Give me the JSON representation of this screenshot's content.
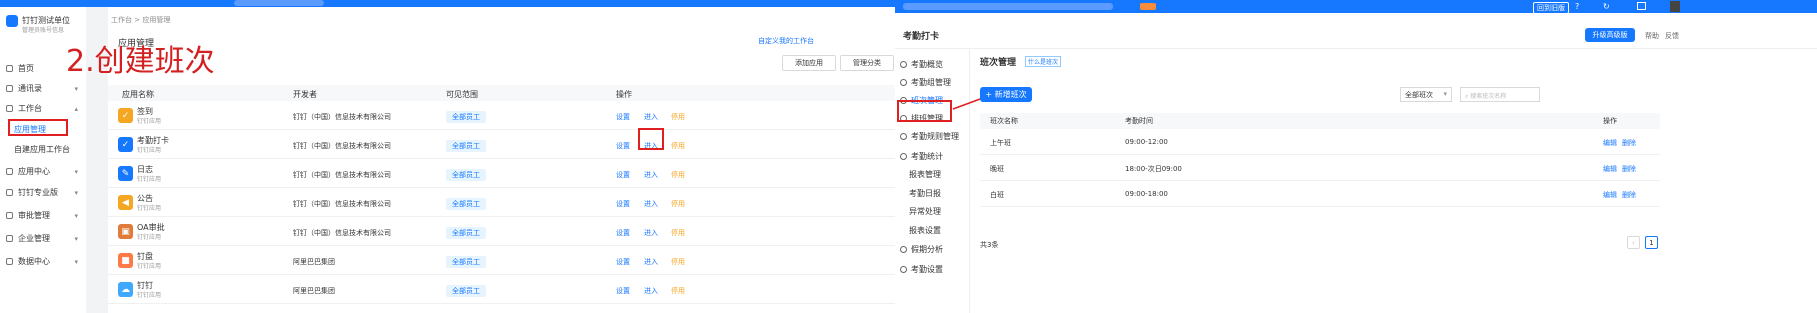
{
  "left": {
    "sidebar": {
      "user_name": "钉钉测试单位",
      "user_sub": "管理员账号信息",
      "items": [
        {
          "label": "首页",
          "caret": ""
        },
        {
          "label": "通讯录",
          "caret": "▾"
        },
        {
          "label": "工作台",
          "caret": "▴"
        },
        {
          "label": "应用管理",
          "caret": ""
        },
        {
          "label": "自建应用工作台",
          "caret": ""
        },
        {
          "label": "应用中心",
          "caret": "▾"
        },
        {
          "label": "钉钉专业版",
          "caret": "▾"
        },
        {
          "label": "审批管理",
          "caret": "▾"
        },
        {
          "label": "企业管理",
          "caret": "▾"
        },
        {
          "label": "数据中心",
          "caret": "▾"
        }
      ]
    },
    "header": {
      "breadcrumb": "工作台 > 应用管理",
      "section_title": "应用管理",
      "link": "自定义我的工作台",
      "btn1": "添加应用",
      "btn2": "管理分类"
    },
    "step_label": "2.创建班次",
    "table": {
      "headers": [
        "应用名称",
        "开发者",
        "可见范围",
        "操作"
      ],
      "rows": [
        {
          "name": "签到",
          "sub": "钉钉应用",
          "dev": "钉钉（中国）信息技术有限公司",
          "scope": "全部员工",
          "color": "#f5a623",
          "icon": "✓",
          "a1": "设置",
          "a2": "进入",
          "a3": "停用"
        },
        {
          "name": "考勤打卡",
          "sub": "钉钉应用",
          "dev": "钉钉（中国）信息技术有限公司",
          "scope": "全部员工",
          "color": "#1677ff",
          "icon": "✓",
          "a1": "设置",
          "a2": "进入",
          "a3": "停用"
        },
        {
          "name": "日志",
          "sub": "钉钉应用",
          "dev": "钉钉（中国）信息技术有限公司",
          "scope": "全部员工",
          "color": "#1677ff",
          "icon": "✎",
          "a1": "设置",
          "a2": "进入",
          "a3": "停用"
        },
        {
          "name": "公告",
          "sub": "钉钉应用",
          "dev": "钉钉（中国）信息技术有限公司",
          "scope": "全部员工",
          "color": "#f5a623",
          "icon": "◀",
          "a1": "设置",
          "a2": "进入",
          "a3": "停用"
        },
        {
          "name": "OA审批",
          "sub": "钉钉应用",
          "dev": "钉钉（中国）信息技术有限公司",
          "scope": "全部员工",
          "color": "#e07b39",
          "icon": "▣",
          "a1": "设置",
          "a2": "进入",
          "a3": "停用"
        },
        {
          "name": "钉盘",
          "sub": "钉钉应用",
          "dev": "阿里巴巴集团",
          "scope": "全部员工",
          "color": "#ff7a45",
          "icon": "■",
          "a1": "设置",
          "a2": "进入",
          "a3": "停用"
        },
        {
          "name": "钉钉",
          "sub": "钉钉应用",
          "dev": "阿里巴巴集团",
          "scope": "全部员工",
          "color": "#40a9ff",
          "icon": "☁",
          "a1": "设置",
          "a2": "进入",
          "a3": "停用"
        }
      ]
    }
  },
  "right": {
    "top_btn": "回到旧版",
    "app_title": "考勤打卡",
    "upgrade": "升级高级版",
    "help1": "帮助",
    "help2": "反馈",
    "nav": [
      {
        "label": "考勤概览"
      },
      {
        "label": "考勤组管理"
      },
      {
        "label": "班次管理"
      },
      {
        "label": "排班管理"
      },
      {
        "label": "考勤规则管理"
      },
      {
        "label": "考勤统计"
      },
      {
        "label": "报表管理"
      },
      {
        "label": "考勤日报"
      },
      {
        "label": "异常处理"
      },
      {
        "label": "报表设置"
      },
      {
        "label": "假期分析"
      },
      {
        "label": "考勤设置"
      }
    ],
    "page_title": "班次管理",
    "page_badge": "什么是班次",
    "new_btn": "+ 新增班次",
    "filter": "全部班次",
    "search_ph": "搜索班次名称",
    "headers": [
      "班次名称",
      "考勤时间",
      "操作"
    ],
    "rows": [
      {
        "name": "上午班",
        "time": "09:00-12:00",
        "edit": "编辑",
        "del": "删除"
      },
      {
        "name": "晚班",
        "time": "18:00-次日09:00",
        "edit": "编辑",
        "del": "删除"
      },
      {
        "name": "白班",
        "time": "09:00-18:00",
        "edit": "编辑",
        "del": "删除"
      }
    ],
    "total": "共3条",
    "page": "1"
  }
}
